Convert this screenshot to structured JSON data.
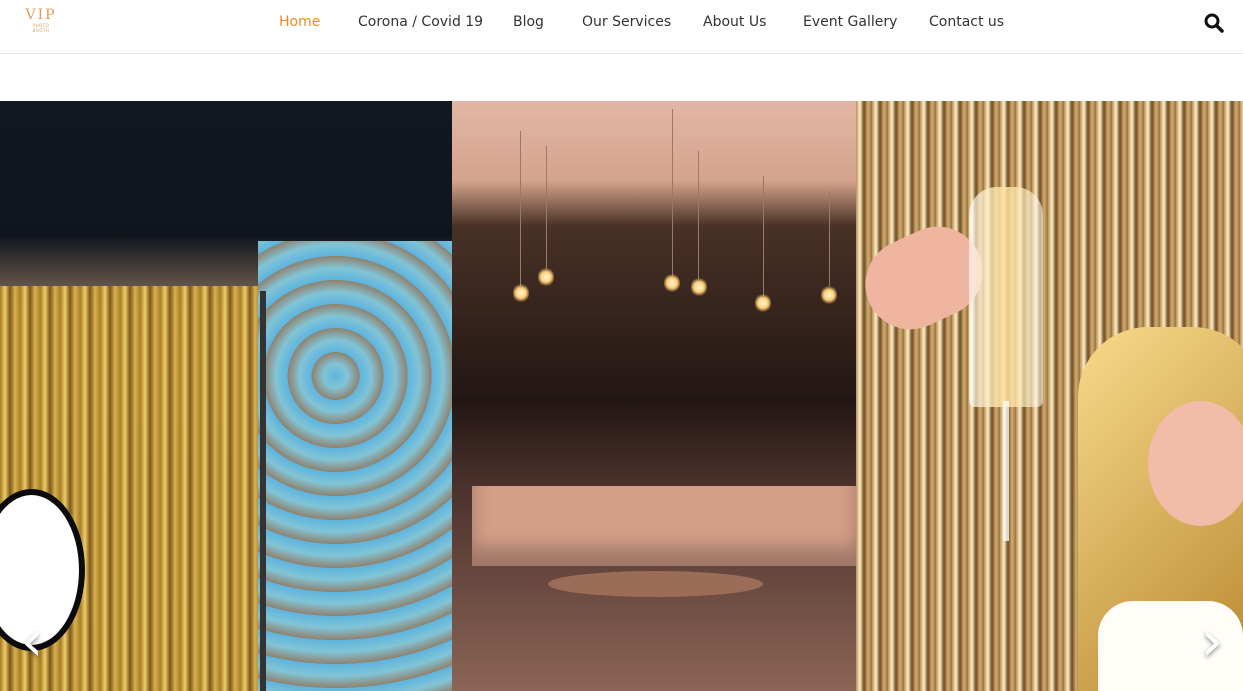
{
  "logo": {
    "big": "VIP",
    "small_line1": "PHOTO",
    "small_line2": "BOOTH"
  },
  "nav": {
    "items": [
      {
        "label": "Home",
        "active": true
      },
      {
        "label": "Corona / Covid 19",
        "active": false
      },
      {
        "label": "Blog",
        "active": false
      },
      {
        "label": "Our Services",
        "active": false
      },
      {
        "label": "About Us",
        "active": false
      },
      {
        "label": "Event Gallery",
        "active": false
      },
      {
        "label": "Contact us",
        "active": false
      }
    ]
  },
  "search": {
    "icon": "search-icon"
  },
  "slider": {
    "prev_icon": "chevron-left-icon",
    "next_icon": "chevron-right-icon",
    "prev_glyph": "‹",
    "next_glyph": "›"
  },
  "colors": {
    "accent": "#f08a24",
    "nav_text": "#333333",
    "logo": "#e09a5b"
  }
}
